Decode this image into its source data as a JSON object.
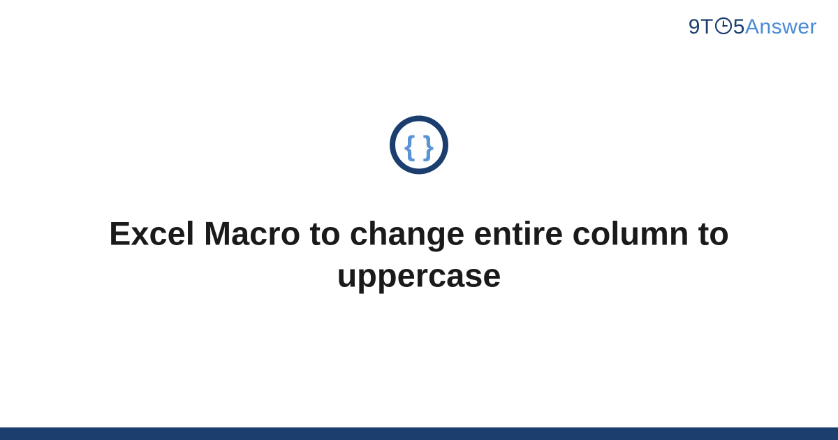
{
  "logo": {
    "nine": "9",
    "t": "T",
    "five": "5",
    "answer": "Answer"
  },
  "title": "Excel Macro to change entire column to uppercase",
  "colors": {
    "darkBlue": "#1b3e6f",
    "lightBlue": "#4a8ad4",
    "footerBlue": "#1b3e6f"
  }
}
